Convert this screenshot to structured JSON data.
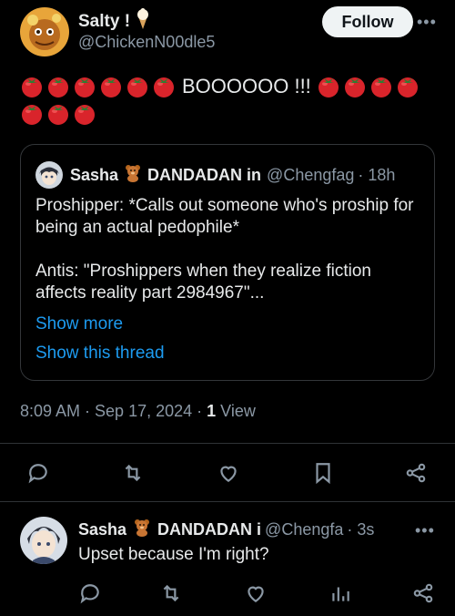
{
  "main_tweet": {
    "author_name": "Salty !",
    "author_handle": "@ChickenN00dle5",
    "follow_label": "Follow",
    "more_label": "•••",
    "text_word": "BOOOOOO !!!",
    "timestamp": "8:09 AM · Sep 17, 2024 · ",
    "views_count": "1",
    "views_label": " View"
  },
  "quote": {
    "author_name": "Sasha",
    "author_name_suffix": "DANDADAN in",
    "author_handle": "@Chengfag",
    "age": "· 18h",
    "paragraph1": "Proshipper: *Calls out someone who's proship for being an actual pedophile*",
    "paragraph2": "Antis: \"Proshippers when they realize fiction affects reality part 2984967\"...",
    "show_more": "Show more",
    "show_thread": "Show this thread"
  },
  "reply": {
    "author_name": "Sasha",
    "author_name_suffix": "DANDADAN i",
    "author_handle": "@Chengfa",
    "age": "· 3s",
    "text": "Upset because I'm right?"
  },
  "icons": {
    "actions": [
      "reply-icon",
      "retweet-icon",
      "like-icon",
      "bookmark-icon",
      "share-icon"
    ],
    "reply_actions": [
      "reply-icon",
      "retweet-icon",
      "like-icon",
      "views-icon",
      "share-icon"
    ]
  },
  "colors": {
    "accent": "#1d9bf0",
    "secondary_text": "#8b98a5",
    "tomato": "#d9242b"
  }
}
